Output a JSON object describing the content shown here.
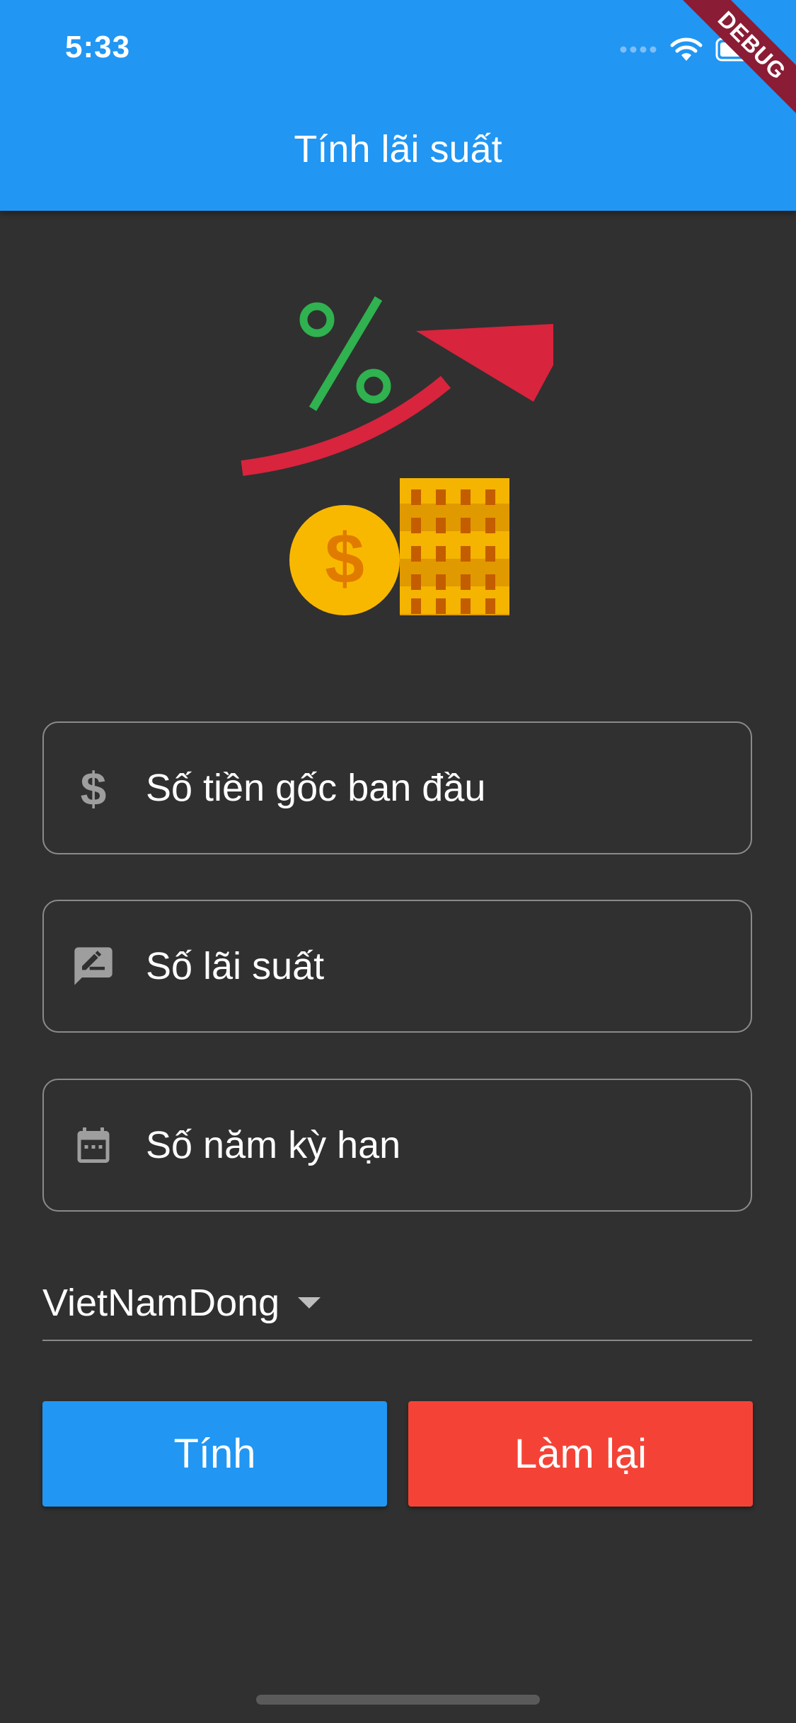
{
  "status_bar": {
    "time": "5:33"
  },
  "debug_banner": "DEBUG",
  "app_bar": {
    "title": "Tính lãi suất"
  },
  "form": {
    "principal": {
      "label": "Số tiền gốc ban đầu",
      "icon": "dollar-icon"
    },
    "rate": {
      "label": "Số lãi suất",
      "icon": "rate-edit-icon"
    },
    "years": {
      "label": "Số năm kỳ hạn",
      "icon": "calendar-icon"
    }
  },
  "currency_dropdown": {
    "selected": "VietNamDong"
  },
  "buttons": {
    "calculate": "Tính",
    "reset": "Làm lại"
  },
  "colors": {
    "primary": "#2196F3",
    "danger": "#F44336",
    "background": "#303030",
    "debug": "#8a1c35"
  }
}
